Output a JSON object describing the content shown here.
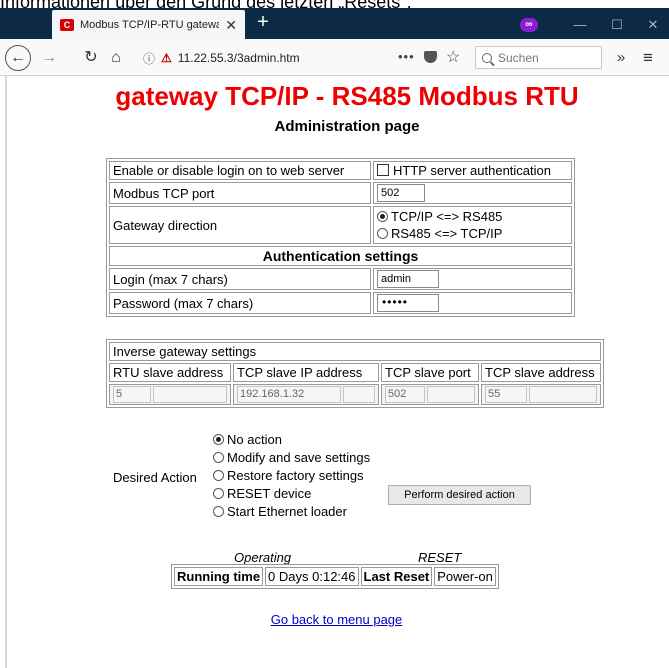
{
  "caption": "Informationen über den Grund des letzten „Resets\":",
  "browser": {
    "tab_title": "Modbus TCP/IP-RTU gateway -",
    "favicon_letter": "C",
    "url": "11.22.55.3/3admin.htm",
    "search_placeholder": "Suchen",
    "accent_color": "#ee0000"
  },
  "page": {
    "title": "gateway TCP/IP - RS485 Modbus RTU",
    "subtitle": "Administration page",
    "config": {
      "login_label": "Enable or disable login on to web server",
      "http_auth_label": "HTTP server authentication",
      "port_label": "Modbus TCP port",
      "port_value": "502",
      "direction_label": "Gateway direction",
      "direction_options": [
        "TCP/IP <=> RS485",
        "RS485 <=> TCP/IP"
      ],
      "auth_section": "Authentication settings",
      "login_field_label": "Login (max 7 chars)",
      "login_value": "admin",
      "password_label": "Password (max 7 chars)",
      "password_mask": "•••••"
    },
    "inverse": {
      "title": "Inverse gateway settings",
      "headers": [
        "RTU slave address",
        "TCP slave IP address",
        "TCP slave port",
        "TCP slave address"
      ],
      "values": [
        "5",
        "192.168.1.32",
        "502",
        "55"
      ]
    },
    "actions": {
      "label": "Desired Action",
      "options": [
        "No action",
        "Modify and save settings",
        "Restore factory settings",
        "RESET device",
        "Start Ethernet loader"
      ],
      "selected": 0,
      "button": "Perform desired action"
    },
    "status": {
      "operating_caption": "Operating",
      "reset_caption": "RESET",
      "running_label": "Running time",
      "running_value": "0 Days 0:12:46",
      "last_reset_label": "Last Reset",
      "last_reset_value": "Power-on"
    },
    "back_link": "Go back to menu page"
  }
}
